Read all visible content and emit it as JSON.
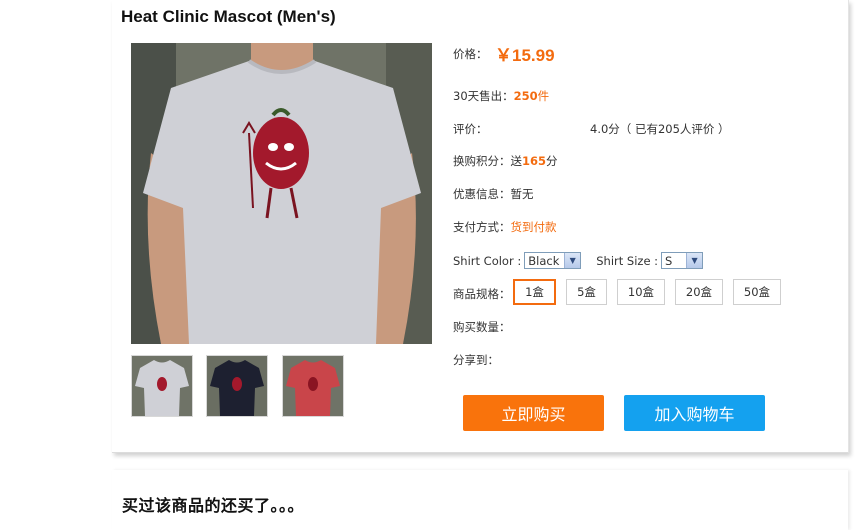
{
  "product": {
    "title": "Heat Clinic Mascot (Men's)",
    "price_label": "价格：",
    "price": "￥15.99",
    "sold_prefix": "30天售出：",
    "sold_count": "250",
    "sold_unit": "件",
    "rating_label": "评价：",
    "rating_value": "4.0分（ 已有205人评价 ）",
    "points_prefix": "换购积分：送",
    "points_value": "165",
    "points_unit": "分",
    "promo": "优惠信息：暂无",
    "pay_label": "支付方式：",
    "pay_value": "货到付款",
    "color_label": "Shirt Color  :",
    "color_value": "Black",
    "size_label": "Shirt Size  :",
    "size_value": "S",
    "spec_label": "商品规格：",
    "specs": [
      "1盒",
      "5盒",
      "10盒",
      "20盒",
      "50盒"
    ],
    "qty_label": "购买数量：",
    "share_label": "分享到：",
    "buy_now": "立即购买",
    "add_cart": "加入购物车"
  },
  "related": {
    "heading": "买过该商品的还买了。。。"
  },
  "colors": {
    "accent_orange": "#f36b0f",
    "buy_button": "#f9730c",
    "cart_button": "#14a1ef"
  },
  "images": [
    "tshirt-grey-main",
    "tshirt-grey-thumb",
    "tshirt-black-thumb",
    "tshirt-red-thumb"
  ]
}
